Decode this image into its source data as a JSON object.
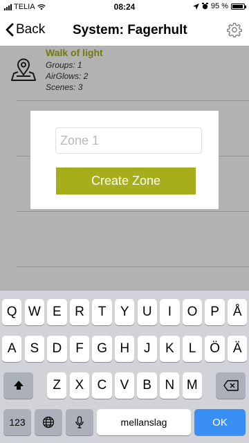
{
  "status_bar": {
    "carrier": "TELIA",
    "time": "08:24",
    "battery_text": "95 %",
    "battery_level": 0.95
  },
  "nav": {
    "back_label": "Back",
    "title": "System: Fagerhult",
    "back_icon": "chevron-left-icon",
    "settings_icon": "gear-icon"
  },
  "system_item": {
    "name": "Walk of light",
    "groups": "Groups: 1",
    "airglows": "AirGlows: 2",
    "scenes": "Scenes: 3",
    "icon": "map-pin-icon"
  },
  "dialog": {
    "zone_placeholder": "Zone 1",
    "zone_value": "",
    "create_label": "Create Zone"
  },
  "keyboard": {
    "row1": [
      "Q",
      "W",
      "E",
      "R",
      "T",
      "Y",
      "U",
      "I",
      "O",
      "P",
      "Å"
    ],
    "row2": [
      "A",
      "S",
      "D",
      "F",
      "G",
      "H",
      "J",
      "K",
      "L",
      "Ö",
      "Ä"
    ],
    "row3": [
      "Z",
      "X",
      "C",
      "V",
      "B",
      "N",
      "M"
    ],
    "numbers_label": "123",
    "space_label": "mellanslag",
    "return_label": "OK"
  },
  "colors": {
    "accent": "#a6ae1c",
    "keyboard_bg": "#d1d3d9",
    "ok_key": "#3a8ff4"
  }
}
